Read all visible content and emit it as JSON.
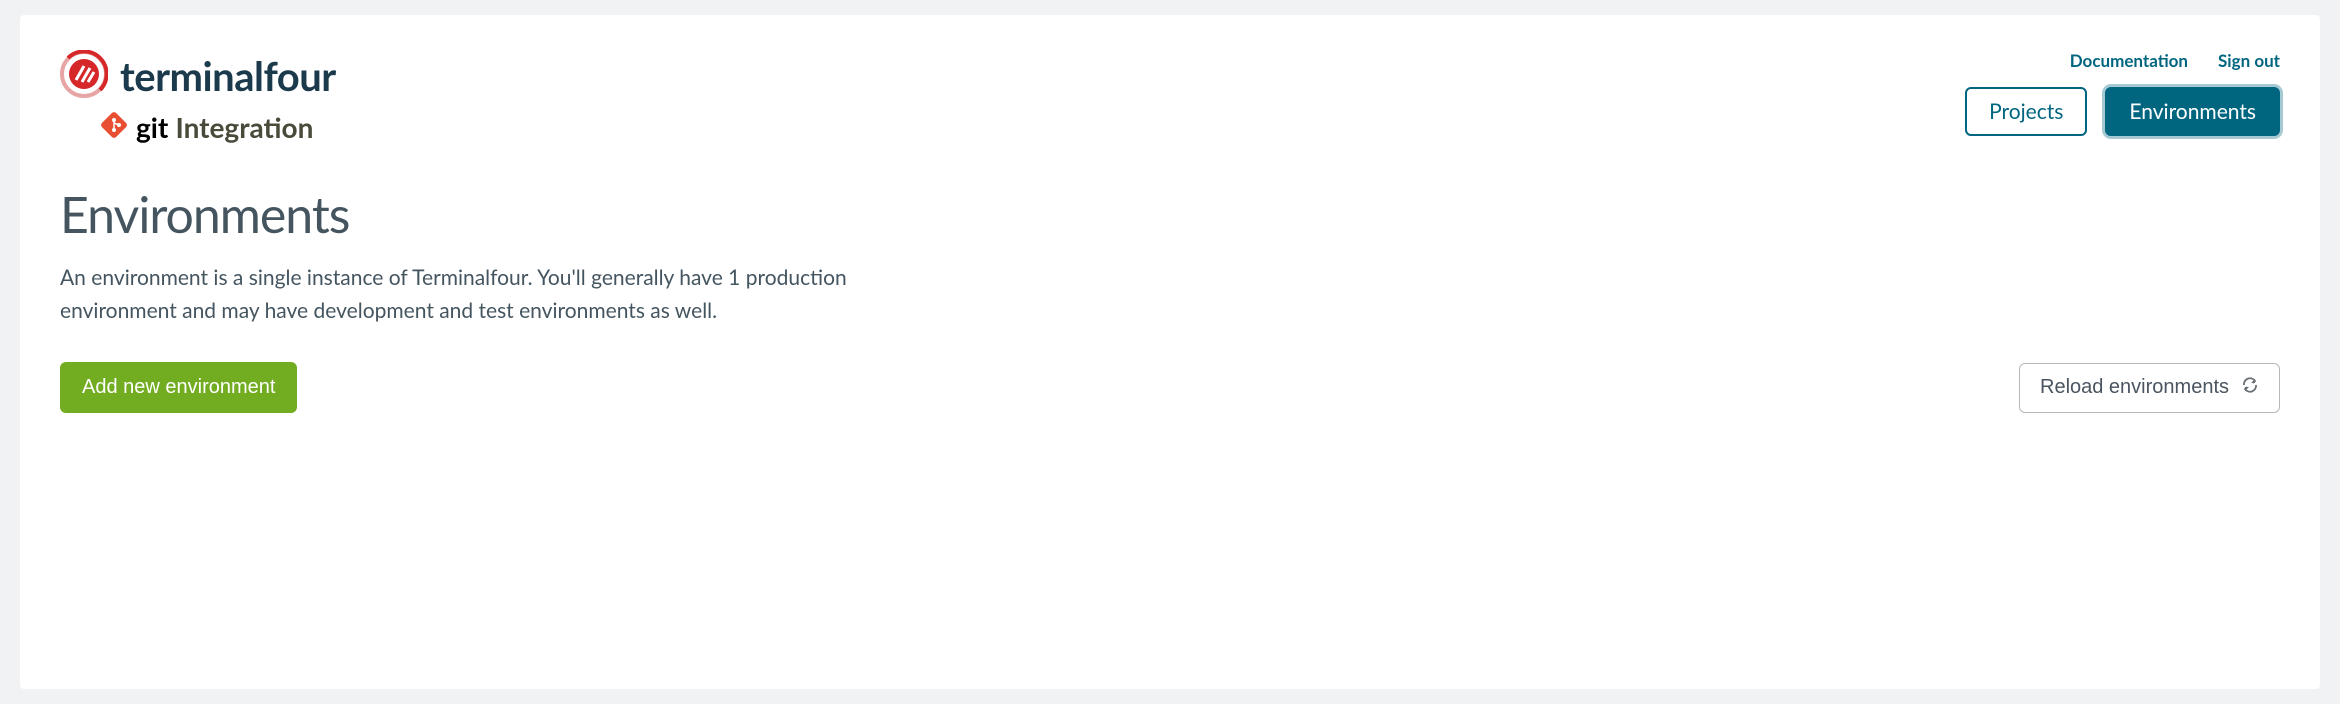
{
  "branding": {
    "main_text": "terminalfour",
    "sub_git": "git",
    "sub_integration": "Integration"
  },
  "top_links": {
    "documentation": "Documentation",
    "sign_out": "Sign out"
  },
  "nav": {
    "projects": "Projects",
    "environments": "Environments"
  },
  "page": {
    "title": "Environments",
    "description": "An environment is a single instance of Terminalfour. You'll generally have 1 production environment and may have development and test environments as well."
  },
  "actions": {
    "add_new": "Add new environment",
    "reload": "Reload environments"
  }
}
